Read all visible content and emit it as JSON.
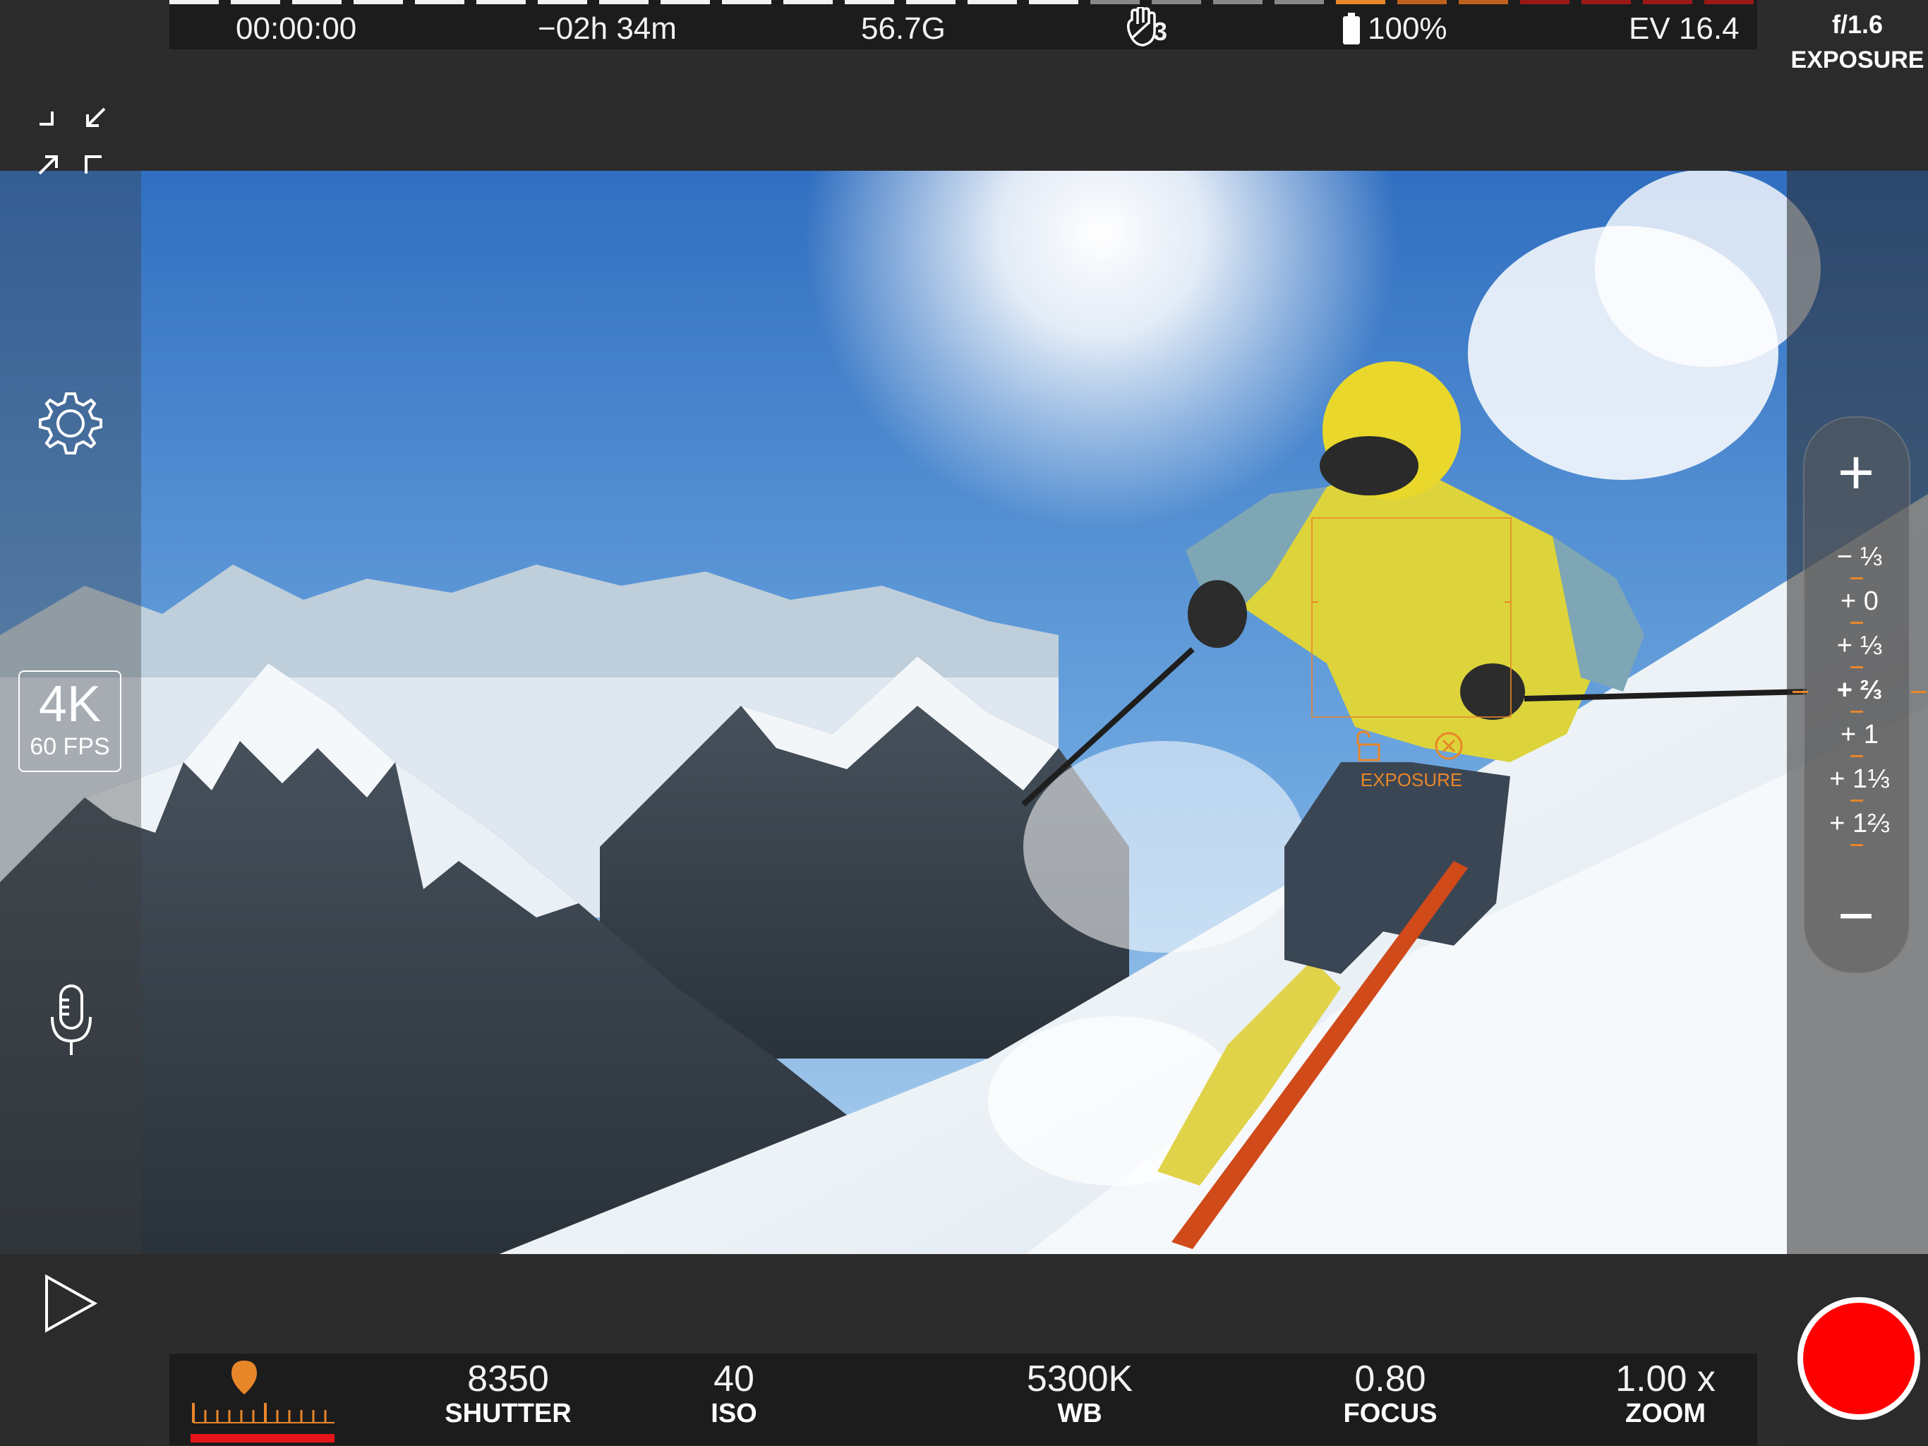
{
  "status": {
    "timecode": "00:00:00",
    "remaining_time": "−02h 34m",
    "storage": "56.7G",
    "stabilization_level": "3",
    "battery": "100%",
    "ev": "EV 16.4"
  },
  "aperture": {
    "value": "f/1.6",
    "mode": "EXPOSURE"
  },
  "resolution": {
    "size": "4K",
    "fps": "60 FPS"
  },
  "icons": {
    "collapse": "collapse-arrows-icon",
    "settings": "gear-icon",
    "microphone": "microphone-icon",
    "play": "play-icon",
    "stabilization": "hand-stabilization-icon",
    "battery": "battery-icon",
    "lock": "unlock-icon",
    "close": "close-circle-icon",
    "audio_meter": "audio-meter-icon"
  },
  "exposure_panel": {
    "plus": "+",
    "minus": "−",
    "steps": [
      "− ⅓",
      "+ 0",
      "+ ⅓",
      "+ ⅔",
      "+ 1",
      "+ 1⅓",
      "+ 1⅔"
    ],
    "selected_index": 3
  },
  "reticle": {
    "label": "EXPOSURE"
  },
  "controls": {
    "shutter": {
      "value": "8350",
      "label": "SHUTTER"
    },
    "iso": {
      "value": "40",
      "label": "ISO"
    },
    "wb": {
      "value": "5300K",
      "label": "WB"
    },
    "focus": {
      "value": "0.80",
      "label": "FOCUS"
    },
    "zoom": {
      "value": "1.00 x",
      "label": "ZOOM"
    }
  },
  "colors": {
    "accent": "#e8862a",
    "record": "#ff0000",
    "meter_bar": "#e5161b"
  }
}
